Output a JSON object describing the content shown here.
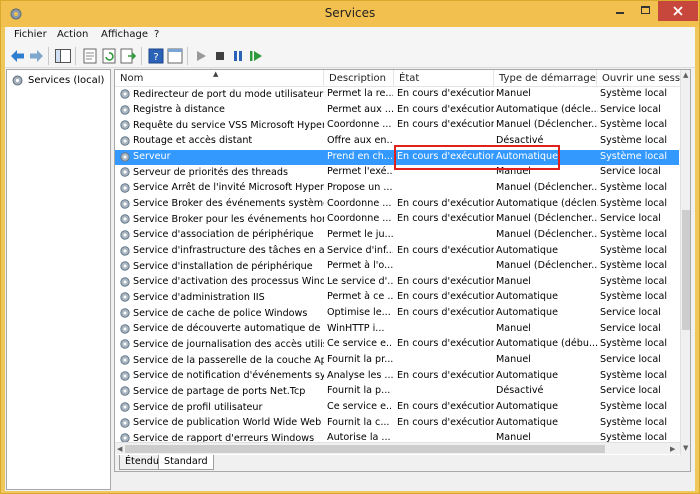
{
  "window": {
    "title": "Services"
  },
  "menu": [
    "Fichier",
    "Action",
    "Affichage",
    "?"
  ],
  "left_pane": {
    "tree_item": "Services (local)"
  },
  "columns": [
    "Nom",
    "Description",
    "État",
    "Type de démarrage",
    "Ouvrir une session"
  ],
  "rows": [
    {
      "name": "Redirecteur de port du mode utilisateur d...",
      "desc": "Permet la re...",
      "state": "En cours d'exécution",
      "type": "Manuel",
      "logon": "Système local"
    },
    {
      "name": "Registre à distance",
      "desc": "Permet aux ...",
      "state": "En cours d'exécution",
      "type": "Automatique (décle...",
      "logon": "Service local"
    },
    {
      "name": "Requête du service VSS Microsoft Hyper-V",
      "desc": "Coordonne ...",
      "state": "En cours d'exécution",
      "type": "Manuel (Déclencher...",
      "logon": "Système local"
    },
    {
      "name": "Routage et accès distant",
      "desc": "Offre aux en...",
      "state": "",
      "type": "Désactivé",
      "logon": "Système local"
    },
    {
      "name": "Serveur",
      "desc": "Prend en ch...",
      "state": "En cours d'exécution",
      "type": "Automatique",
      "logon": "Système local",
      "selected": true
    },
    {
      "name": "Serveur de priorités des threads",
      "desc": "Permet l'exé...",
      "state": "",
      "type": "Manuel",
      "logon": "Service local"
    },
    {
      "name": "Service Arrêt de l'invité Microsoft Hyper-V",
      "desc": "Propose un ...",
      "state": "",
      "type": "Manuel (Déclencher...",
      "logon": "Système local"
    },
    {
      "name": "Service Broker des événements système",
      "desc": "Coordonne ...",
      "state": "En cours d'exécution",
      "type": "Automatique (déclen...",
      "logon": "Système local"
    },
    {
      "name": "Service Broker pour les événements horaires",
      "desc": "Coordonne ...",
      "state": "En cours d'exécution",
      "type": "Manuel (Déclencher...",
      "logon": "Service local"
    },
    {
      "name": "Service d'association de périphérique",
      "desc": "Permet le ju...",
      "state": "",
      "type": "Manuel (Déclencher...",
      "logon": "Système local"
    },
    {
      "name": "Service d'infrastructure des tâches en arriè...",
      "desc": "Service d'inf...",
      "state": "En cours d'exécution",
      "type": "Automatique",
      "logon": "Système local"
    },
    {
      "name": "Service d'installation de périphérique",
      "desc": "Permet à l'o...",
      "state": "",
      "type": "Manuel (Déclencher...",
      "logon": "Système local"
    },
    {
      "name": "Service d'activation des processus Windows",
      "desc": "Le service d'...",
      "state": "En cours d'exécution",
      "type": "Manuel",
      "logon": "Système local"
    },
    {
      "name": "Service d'administration IIS",
      "desc": "Permet à ce ...",
      "state": "En cours d'exécution",
      "type": "Automatique",
      "logon": "Système local"
    },
    {
      "name": "Service de cache de police Windows",
      "desc": "Optimise le...",
      "state": "En cours d'exécution",
      "type": "Automatique",
      "logon": "Service local"
    },
    {
      "name": "Service de découverte automatique de Pr...",
      "desc": "WinHTTP i...",
      "state": "",
      "type": "Manuel",
      "logon": "Service local"
    },
    {
      "name": "Service de journalisation des accès utilisat...",
      "desc": "Ce service e...",
      "state": "En cours d'exécution",
      "type": "Automatique (débu...",
      "logon": "Système local"
    },
    {
      "name": "Service de la passerelle de la couche Appli...",
      "desc": "Fournit la pr...",
      "state": "",
      "type": "Manuel",
      "logon": "Service local"
    },
    {
      "name": "Service de notification d'événements syst...",
      "desc": "Analyse les ...",
      "state": "En cours d'exécution",
      "type": "Automatique",
      "logon": "Système local"
    },
    {
      "name": "Service de partage de ports Net.Tcp",
      "desc": "Fournit la p...",
      "state": "",
      "type": "Désactivé",
      "logon": "Service local"
    },
    {
      "name": "Service de profil utilisateur",
      "desc": "Ce service e...",
      "state": "En cours d'exécution",
      "type": "Automatique",
      "logon": "Système local"
    },
    {
      "name": "Service de publication World Wide Web",
      "desc": "Fournit la c...",
      "state": "En cours d'exécution",
      "type": "Automatique",
      "logon": "Système local"
    },
    {
      "name": "Service de rapport d'erreurs Windows",
      "desc": "Autorise la ...",
      "state": "",
      "type": "Manuel",
      "logon": "Système local"
    }
  ],
  "tabs": [
    "Étendu",
    "Standard"
  ],
  "colors": {
    "title_bar": "#f2c04f",
    "selection": "#3399ff",
    "close_button": "#c7473c",
    "highlight": "#e0201a"
  }
}
